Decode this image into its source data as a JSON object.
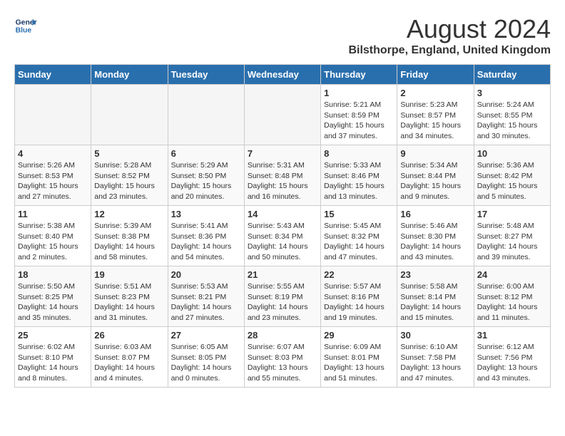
{
  "header": {
    "logo_line1": "General",
    "logo_line2": "Blue",
    "month_year": "August 2024",
    "location": "Bilsthorpe, England, United Kingdom"
  },
  "weekdays": [
    "Sunday",
    "Monday",
    "Tuesday",
    "Wednesday",
    "Thursday",
    "Friday",
    "Saturday"
  ],
  "weeks": [
    [
      {
        "day": "",
        "info": ""
      },
      {
        "day": "",
        "info": ""
      },
      {
        "day": "",
        "info": ""
      },
      {
        "day": "",
        "info": ""
      },
      {
        "day": "1",
        "info": "Sunrise: 5:21 AM\nSunset: 8:59 PM\nDaylight: 15 hours\nand 37 minutes."
      },
      {
        "day": "2",
        "info": "Sunrise: 5:23 AM\nSunset: 8:57 PM\nDaylight: 15 hours\nand 34 minutes."
      },
      {
        "day": "3",
        "info": "Sunrise: 5:24 AM\nSunset: 8:55 PM\nDaylight: 15 hours\nand 30 minutes."
      }
    ],
    [
      {
        "day": "4",
        "info": "Sunrise: 5:26 AM\nSunset: 8:53 PM\nDaylight: 15 hours\nand 27 minutes."
      },
      {
        "day": "5",
        "info": "Sunrise: 5:28 AM\nSunset: 8:52 PM\nDaylight: 15 hours\nand 23 minutes."
      },
      {
        "day": "6",
        "info": "Sunrise: 5:29 AM\nSunset: 8:50 PM\nDaylight: 15 hours\nand 20 minutes."
      },
      {
        "day": "7",
        "info": "Sunrise: 5:31 AM\nSunset: 8:48 PM\nDaylight: 15 hours\nand 16 minutes."
      },
      {
        "day": "8",
        "info": "Sunrise: 5:33 AM\nSunset: 8:46 PM\nDaylight: 15 hours\nand 13 minutes."
      },
      {
        "day": "9",
        "info": "Sunrise: 5:34 AM\nSunset: 8:44 PM\nDaylight: 15 hours\nand 9 minutes."
      },
      {
        "day": "10",
        "info": "Sunrise: 5:36 AM\nSunset: 8:42 PM\nDaylight: 15 hours\nand 5 minutes."
      }
    ],
    [
      {
        "day": "11",
        "info": "Sunrise: 5:38 AM\nSunset: 8:40 PM\nDaylight: 15 hours\nand 2 minutes."
      },
      {
        "day": "12",
        "info": "Sunrise: 5:39 AM\nSunset: 8:38 PM\nDaylight: 14 hours\nand 58 minutes."
      },
      {
        "day": "13",
        "info": "Sunrise: 5:41 AM\nSunset: 8:36 PM\nDaylight: 14 hours\nand 54 minutes."
      },
      {
        "day": "14",
        "info": "Sunrise: 5:43 AM\nSunset: 8:34 PM\nDaylight: 14 hours\nand 50 minutes."
      },
      {
        "day": "15",
        "info": "Sunrise: 5:45 AM\nSunset: 8:32 PM\nDaylight: 14 hours\nand 47 minutes."
      },
      {
        "day": "16",
        "info": "Sunrise: 5:46 AM\nSunset: 8:30 PM\nDaylight: 14 hours\nand 43 minutes."
      },
      {
        "day": "17",
        "info": "Sunrise: 5:48 AM\nSunset: 8:27 PM\nDaylight: 14 hours\nand 39 minutes."
      }
    ],
    [
      {
        "day": "18",
        "info": "Sunrise: 5:50 AM\nSunset: 8:25 PM\nDaylight: 14 hours\nand 35 minutes."
      },
      {
        "day": "19",
        "info": "Sunrise: 5:51 AM\nSunset: 8:23 PM\nDaylight: 14 hours\nand 31 minutes."
      },
      {
        "day": "20",
        "info": "Sunrise: 5:53 AM\nSunset: 8:21 PM\nDaylight: 14 hours\nand 27 minutes."
      },
      {
        "day": "21",
        "info": "Sunrise: 5:55 AM\nSunset: 8:19 PM\nDaylight: 14 hours\nand 23 minutes."
      },
      {
        "day": "22",
        "info": "Sunrise: 5:57 AM\nSunset: 8:16 PM\nDaylight: 14 hours\nand 19 minutes."
      },
      {
        "day": "23",
        "info": "Sunrise: 5:58 AM\nSunset: 8:14 PM\nDaylight: 14 hours\nand 15 minutes."
      },
      {
        "day": "24",
        "info": "Sunrise: 6:00 AM\nSunset: 8:12 PM\nDaylight: 14 hours\nand 11 minutes."
      }
    ],
    [
      {
        "day": "25",
        "info": "Sunrise: 6:02 AM\nSunset: 8:10 PM\nDaylight: 14 hours\nand 8 minutes."
      },
      {
        "day": "26",
        "info": "Sunrise: 6:03 AM\nSunset: 8:07 PM\nDaylight: 14 hours\nand 4 minutes."
      },
      {
        "day": "27",
        "info": "Sunrise: 6:05 AM\nSunset: 8:05 PM\nDaylight: 14 hours\nand 0 minutes."
      },
      {
        "day": "28",
        "info": "Sunrise: 6:07 AM\nSunset: 8:03 PM\nDaylight: 13 hours\nand 55 minutes."
      },
      {
        "day": "29",
        "info": "Sunrise: 6:09 AM\nSunset: 8:01 PM\nDaylight: 13 hours\nand 51 minutes."
      },
      {
        "day": "30",
        "info": "Sunrise: 6:10 AM\nSunset: 7:58 PM\nDaylight: 13 hours\nand 47 minutes."
      },
      {
        "day": "31",
        "info": "Sunrise: 6:12 AM\nSunset: 7:56 PM\nDaylight: 13 hours\nand 43 minutes."
      }
    ]
  ]
}
